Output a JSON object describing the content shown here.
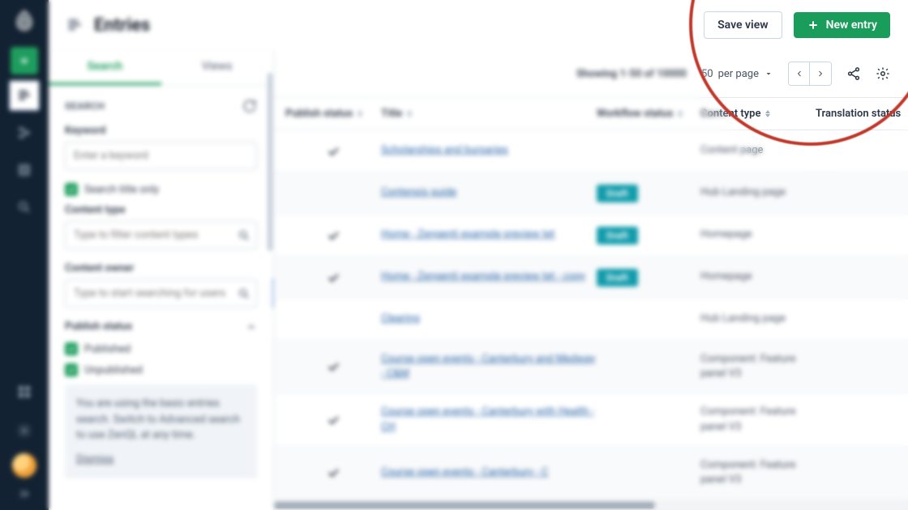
{
  "rail": {
    "items": [
      "dashboard",
      "entries",
      "structure",
      "library",
      "search"
    ]
  },
  "header": {
    "title": "Entries",
    "save_view": "Save view",
    "new_entry": "New entry"
  },
  "filter": {
    "tabs": {
      "search": "Search",
      "views": "Views"
    },
    "heading": "SEARCH",
    "keyword_label": "Keyword",
    "keyword_placeholder": "Enter a keyword",
    "search_title_only": "Search title only",
    "content_type_label": "Content type",
    "content_type_placeholder": "Type to filter content types",
    "content_owner_label": "Content owner",
    "content_owner_placeholder": "Type to start searching for users",
    "publish_status_label": "Publish status",
    "published": "Published",
    "unpublished": "Unpublished",
    "notice": "You are using the basic entries search. Switch to Advanced search to use ZenQL at any time.",
    "dismiss": "Dismiss"
  },
  "toolbar": {
    "showing": "Showing 1-50 of 10000",
    "per_page_value": "50",
    "per_page_suffix": " per page"
  },
  "table": {
    "headers": {
      "publish_status": "Publish status",
      "title": "Title",
      "workflow_status": "Workflow status",
      "content_type": "Content type",
      "translation_status": "Translation status"
    },
    "rows": [
      {
        "published": true,
        "title": "Scholarships and bursaries",
        "workflow": "",
        "content_type": "Content page"
      },
      {
        "published": false,
        "title": "Contensis guide",
        "workflow": "Draft",
        "content_type": "Hub Landing page"
      },
      {
        "published": true,
        "title": "Home - Zengenti example preview tet",
        "workflow": "Draft",
        "content_type": "Homepage"
      },
      {
        "published": true,
        "title": "Home - Zengenti example preview tet - copy",
        "workflow": "Draft",
        "content_type": "Homepage"
      },
      {
        "published": false,
        "title": "Clearing",
        "workflow": "",
        "content_type": "Hub Landing page"
      },
      {
        "published": true,
        "title": "Course open events - Canterbury and Medway - C&M",
        "workflow": "",
        "content_type": "Component: Feature panel V3"
      },
      {
        "published": true,
        "title": "Course open events - Canterbury with Health - CH",
        "workflow": "",
        "content_type": "Component: Feature panel V3"
      },
      {
        "published": true,
        "title": "Course open events - Canterbury - C",
        "workflow": "",
        "content_type": "Component: Feature panel V3"
      }
    ]
  }
}
